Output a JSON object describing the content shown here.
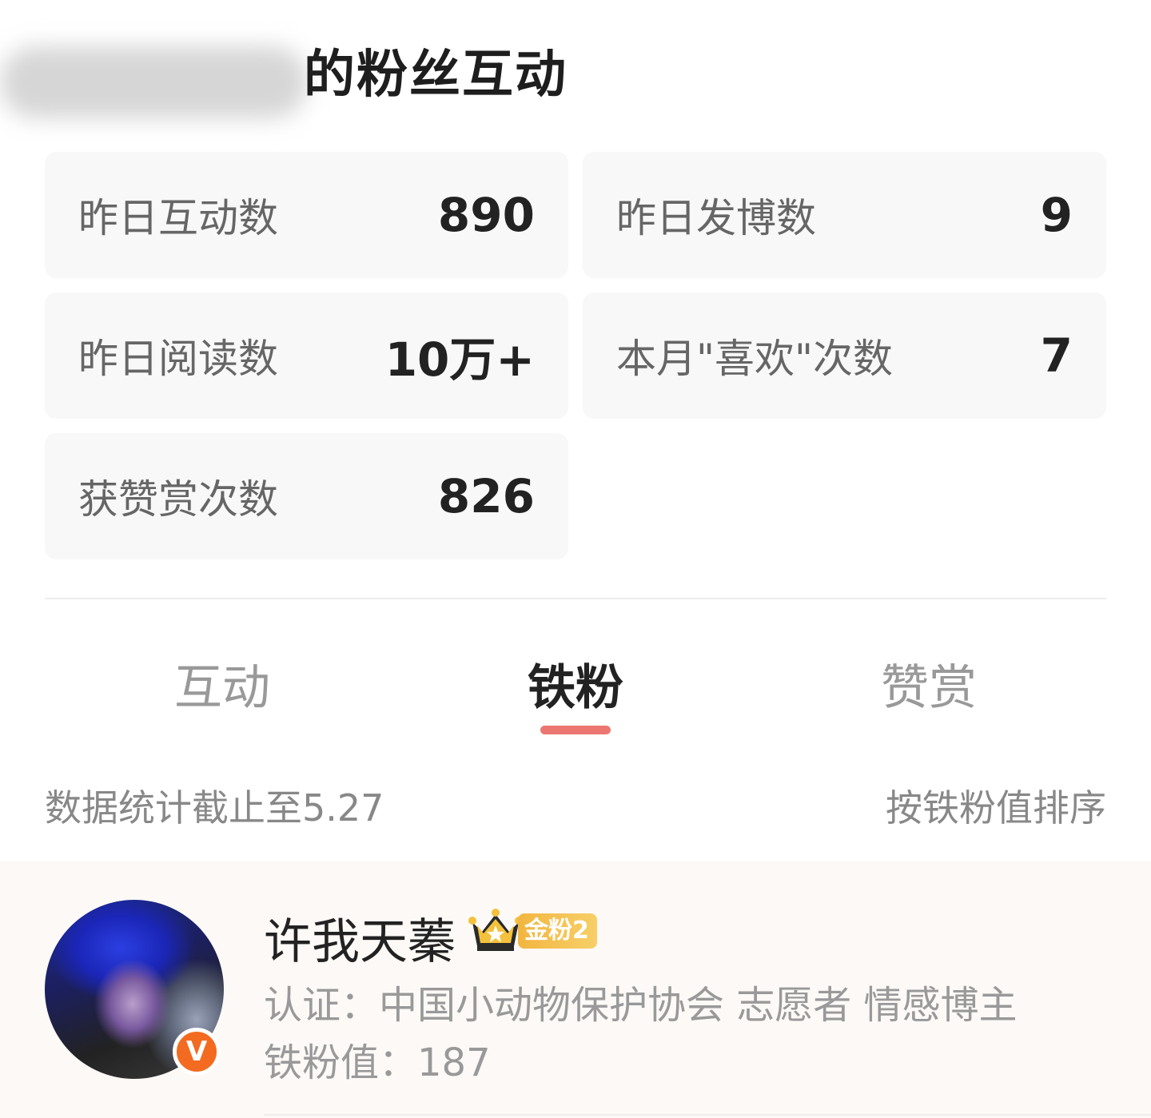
{
  "header": {
    "title": "的粉丝互动"
  },
  "stats": [
    {
      "label": "昨日互动数",
      "value": "890"
    },
    {
      "label": "昨日发博数",
      "value": "9"
    },
    {
      "label": "昨日阅读数",
      "value": "10万+"
    },
    {
      "label": "本月\"喜欢\"次数",
      "value": "7"
    },
    {
      "label": "获赞赏次数",
      "value": "826"
    }
  ],
  "tabs": [
    {
      "label": "互动",
      "active": false
    },
    {
      "label": "铁粉",
      "active": true
    },
    {
      "label": "赞赏",
      "active": false
    }
  ],
  "meta": {
    "stat_cutoff": "数据统计截止至5.27",
    "sort_label": "按铁粉值排序"
  },
  "fans": [
    {
      "name": "许我天蓁",
      "badge": "金粉2",
      "cert": "认证：中国小动物保护协会 志愿者 情感博主",
      "iron_value": "铁粉值：187",
      "verified_mark": "V"
    }
  ],
  "colors": {
    "accent": "#ec7671",
    "verified": "#f36b21",
    "badge_gold": "#f2b640"
  }
}
